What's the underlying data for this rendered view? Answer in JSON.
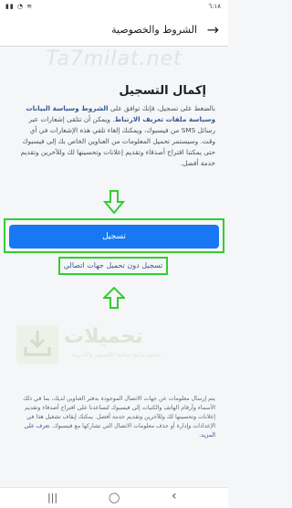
{
  "status_bar": {
    "time": "٦:١٨",
    "icons": "▮▮ ◔ ≋"
  },
  "header": {
    "title": "الشروط والخصوصية",
    "back_icon": "arrow-right-icon"
  },
  "watermark_top": "Ta7milat.net",
  "card": {
    "title": "إكمال التسجيل",
    "body_parts": [
      "بالضغط على تسجيل، فإنك توافق على ",
      "الشروط وسياسة البيانات وسياسة ملفات تعريف الارتباط",
      ". ويمكن أن تتلقى إشعارات عبر رسائل SMS من فيسبوك، ويمكنك إلغاء تلقي هذه الإشعارات في أي وقت. وسيستمر تحميل المعلومات من العناوين الخاص بك إلى فيسبوك حتى يمكننا اقتراح أصدقاء وتقديم إعلانات وتحسينها لك وللآخرين وتقديم خدمة أفضل."
    ]
  },
  "actions": {
    "register_button": "تسجيل",
    "register_without_contacts": "تسجيل دون تحميل جهات اتصالي"
  },
  "logo_watermark": {
    "name": "تحميلات",
    "tagline": "تحميل برامج مجانية للكمبيوتر والأندرويد"
  },
  "footer": {
    "text": "يتم إرسال معلومات عن جهات الاتصال الموجودة بدفتر العناوين لديك، بما في ذلك الأسماء وأرقام الهاتف والكنيات إلى فيسبوك لتساعدنا على اقتراح أصدقاء وتقديم إعلانات وتحسينها لك وللآخرين وتقديم خدمة أفضل. يمكنك إيقاف تشغيل هذا في الإعدادات وإدارة أو حذف معلومات الاتصال التي تشاركها مع فيسبوك. ",
    "link": "تعرف على المزيد."
  },
  "nav_bar": {
    "recents_icon": "|||",
    "home_icon": "◯",
    "back_icon": "‹"
  },
  "colors": {
    "primary": "#1877f2",
    "link": "#385898",
    "highlight_green": "#32cd32"
  }
}
